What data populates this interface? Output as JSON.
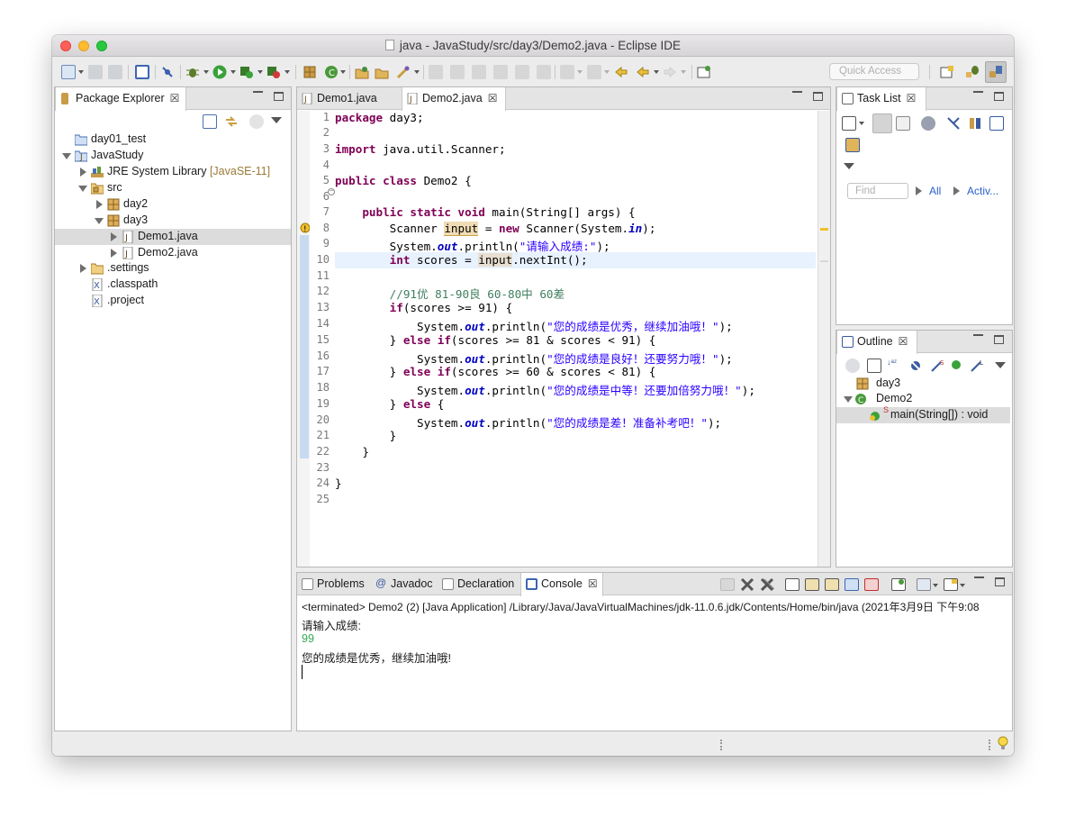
{
  "window": {
    "title": "java - JavaStudy/src/day3/Demo2.java - Eclipse IDE"
  },
  "toolbar": {
    "quick_access_placeholder": "Quick Access"
  },
  "package_explorer": {
    "tab_label": "Package Explorer",
    "tree": [
      {
        "label": "day01_test",
        "icon": "project-folder-icon"
      },
      {
        "label": "JavaStudy",
        "icon": "java-project-icon"
      },
      {
        "label": "JRE System Library",
        "decoration": "[JavaSE-11]",
        "icon": "library-icon"
      },
      {
        "label": "src",
        "icon": "source-folder-icon"
      },
      {
        "label": "day2",
        "icon": "package-icon"
      },
      {
        "label": "day3",
        "icon": "package-icon"
      },
      {
        "label": "Demo1.java",
        "icon": "java-file-icon",
        "selected": true
      },
      {
        "label": "Demo2.java",
        "icon": "java-file-icon"
      },
      {
        "label": ".settings",
        "icon": "folder-icon"
      },
      {
        "label": ".classpath",
        "icon": "xml-file-icon"
      },
      {
        "label": ".project",
        "icon": "xml-file-icon"
      }
    ]
  },
  "editor": {
    "tabs": [
      {
        "label": "Demo1.java",
        "active": false
      },
      {
        "label": "Demo2.java",
        "active": true
      }
    ],
    "line_numbers": [
      "1",
      "2",
      "3",
      "4",
      "5",
      "6",
      "7",
      "8",
      "9",
      "10",
      "11",
      "12",
      "13",
      "14",
      "15",
      "16",
      "17",
      "18",
      "19",
      "20",
      "21",
      "22",
      "23",
      "24",
      "25"
    ],
    "current_line": 10,
    "code": {
      "l1_kw": "package",
      "l1_rest": " day3;",
      "l3_kw": "import",
      "l3_rest": " java.util.Scanner;",
      "l5_kw": "public class",
      "l5_rest": " Demo2 {",
      "l7_kw": "public static void",
      "l7_rest": " main(String[] args) {",
      "l8_a": "Scanner ",
      "l8_var": "input",
      "l8_b": " = ",
      "l8_kw": "new",
      "l8_c": " Scanner(System.",
      "l8_fld": "in",
      "l8_d": ");",
      "l9_a": "System.",
      "l9_fld": "out",
      "l9_b": ".println(",
      "l9_str": "\"请输入成绩:\"",
      "l9_c": ");",
      "l10_kw": "int",
      "l10_a": " scores = ",
      "l10_var": "input",
      "l10_b": ".nextInt();",
      "l12_cm": "//91优 81-90良 60-80中 60差",
      "l13_kw": "if",
      "l13_rest": "(scores >= 91) {",
      "l14_a": "System.",
      "l14_fld": "out",
      "l14_b": ".println(",
      "l14_str": "\"您的成绩是优秀，继续加油哦！\"",
      "l14_c": ");",
      "l15_a": "} ",
      "l15_kw": "else if",
      "l15_rest": "(scores >= 81 & scores < 91) {",
      "l16_a": "System.",
      "l16_fld": "out",
      "l16_b": ".println(",
      "l16_str": "\"您的成绩是良好！还要努力哦！\"",
      "l16_c": ");",
      "l17_a": "} ",
      "l17_kw": "else if",
      "l17_rest": "(scores >= 60 & scores < 81) {",
      "l18_a": "System.",
      "l18_fld": "out",
      "l18_b": ".println(",
      "l18_str": "\"您的成绩是中等！还要加倍努力哦！\"",
      "l18_c": ");",
      "l19_a": "} ",
      "l19_kw": "else",
      "l19_rest": " {",
      "l20_a": "System.",
      "l20_fld": "out",
      "l20_b": ".println(",
      "l20_str": "\"您的成绩是差！准备补考吧！\"",
      "l20_c": ");",
      "l21": "}",
      "l22": "}",
      "l24": "}"
    }
  },
  "task_list": {
    "tab_label": "Task List",
    "find_placeholder": "Find",
    "filter_all": "All",
    "filter_active": "Activ..."
  },
  "outline": {
    "tab_label": "Outline",
    "items": [
      {
        "label": "day3",
        "icon": "package-icon"
      },
      {
        "label": "Demo2",
        "icon": "class-icon"
      },
      {
        "label": "main(String[]) : void",
        "icon": "method-icon",
        "modifier": "S",
        "selected": true
      }
    ]
  },
  "bottom_panel": {
    "tabs": [
      {
        "label": "Problems",
        "icon": "problems-icon"
      },
      {
        "label": "Javadoc",
        "icon": "javadoc-icon"
      },
      {
        "label": "Declaration",
        "icon": "declaration-icon"
      },
      {
        "label": "Console",
        "icon": "console-icon",
        "active": true
      }
    ],
    "console": {
      "header": "<terminated> Demo2 (2) [Java Application] /Library/Java/JavaVirtualMachines/jdk-11.0.6.jdk/Contents/Home/bin/java (2021年3月9日 下午9:08",
      "lines": [
        "请输入成绩:",
        "99",
        "您的成绩是优秀，继续加油哦!"
      ],
      "input_color": "#32a852"
    }
  },
  "colors": {
    "keyword": "#7f0055",
    "string": "#2a00ff",
    "static_field": "#0000c0",
    "comment": "#3f7f5f",
    "current_line_bg": "#e8f2fe"
  }
}
